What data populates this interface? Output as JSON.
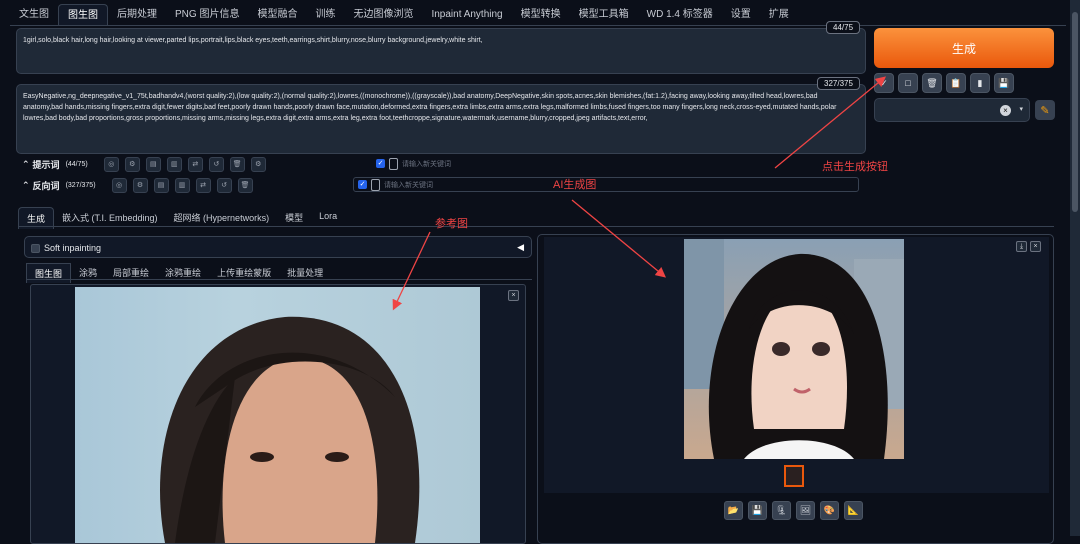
{
  "tabs": [
    "文生图",
    "图生图",
    "后期处理",
    "PNG 图片信息",
    "模型融合",
    "训练",
    "无边图像浏览",
    "Inpaint Anything",
    "模型转换",
    "模型工具箱",
    "WD 1.4 标签器",
    "设置",
    "扩展"
  ],
  "prompt": {
    "text": "1girl,solo,black hair,long hair,looking at viewer,parted lips,portrait,lips,black eyes,teeth,earrings,shirt,blurry,nose,blurry background,jewelry,white shirt,",
    "count": "44/75"
  },
  "negative": {
    "text": "EasyNegative,ng_deepnegative_v1_75t,badhandv4,(worst quality:2),(low quality:2),(normal quality:2),lowres,((monochrome)),((grayscale)),bad anatomy,DeepNegative,skin spots,acnes,skin blemishes,(fat:1.2),facing away,looking away,tilted head,lowres,bad anatomy,bad hands,missing fingers,extra digit,fewer digits,bad feet,poorly drawn hands,poorly drawn face,mutation,deformed,extra fingers,extra limbs,extra arms,extra legs,malformed limbs,fused fingers,too many fingers,long neck,cross-eyed,mutated hands,polar lowres,bad body,bad proportions,gross proportions,missing arms,missing legs,extra digit,extra arms,extra leg,extra foot,teethcroppe,signature,watermark,username,blurry,cropped,jpeg artifacts,text,error,",
    "count": "327/375"
  },
  "generate_label": "生成",
  "prompt_row": {
    "label": "提示词",
    "count": "(44/75)",
    "placeholder": "请输入新关键词"
  },
  "neg_row": {
    "label": "反向词",
    "count": "(327/375)",
    "placeholder": "请输入新关键词"
  },
  "subtabs": [
    "生成",
    "嵌入式 (T.I. Embedding)",
    "超网络 (Hypernetworks)",
    "模型",
    "Lora"
  ],
  "soft_inpainting": "Soft inpainting",
  "img_tabs": [
    "图生图",
    "涂鸦",
    "局部重绘",
    "涂鸦重绘",
    "上传重绘蒙版",
    "批量处理"
  ],
  "annotations": {
    "click_generate": "点击生成按钮",
    "ai_image": "AI生成图",
    "reference": "参考图"
  },
  "colors": {
    "accent": "#ea580c",
    "annotation": "#ef4444",
    "background": "#0b0f19"
  }
}
